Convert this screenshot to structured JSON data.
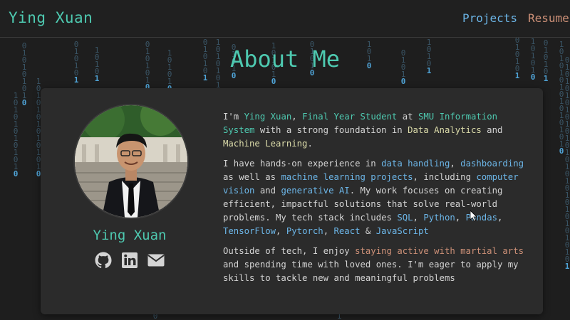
{
  "navbar": {
    "brand": "Ying Xuan",
    "links": [
      {
        "label": "Projects"
      },
      {
        "label": "Resume"
      }
    ]
  },
  "heading": "About Me",
  "profile": {
    "name": "Ying Xuan",
    "socials": [
      "github-icon",
      "linkedin-icon",
      "email-icon"
    ]
  },
  "bio": {
    "p1": [
      {
        "text": "I'm ",
        "style": "plain"
      },
      {
        "text": "Ying Xuan",
        "style": "teal"
      },
      {
        "text": ", ",
        "style": "plain"
      },
      {
        "text": "Final Year Student",
        "style": "teal"
      },
      {
        "text": " at ",
        "style": "plain"
      },
      {
        "text": "SMU Information System",
        "style": "teal"
      },
      {
        "text": " with a strong foundation in ",
        "style": "plain"
      },
      {
        "text": "Data Analytics",
        "style": "yellow"
      },
      {
        "text": " and ",
        "style": "plain"
      },
      {
        "text": "Machine Learning",
        "style": "yellow"
      },
      {
        "text": ".",
        "style": "plain"
      }
    ],
    "p2": [
      {
        "text": "I have hands-on experience in ",
        "style": "plain"
      },
      {
        "text": "data handling",
        "style": "blue"
      },
      {
        "text": ", ",
        "style": "plain"
      },
      {
        "text": "dashboarding",
        "style": "blue"
      },
      {
        "text": " as well as ",
        "style": "plain"
      },
      {
        "text": "machine learning projects",
        "style": "blue"
      },
      {
        "text": ", including ",
        "style": "plain"
      },
      {
        "text": "computer vision",
        "style": "blue"
      },
      {
        "text": " and ",
        "style": "plain"
      },
      {
        "text": "generative AI",
        "style": "blue"
      },
      {
        "text": ". My work focuses on creating efficient, impactful solutions that solve real-world problems. My tech stack includes ",
        "style": "plain"
      },
      {
        "text": "SQL",
        "style": "blue"
      },
      {
        "text": ", ",
        "style": "plain"
      },
      {
        "text": "Python",
        "style": "blue"
      },
      {
        "text": ", ",
        "style": "plain"
      },
      {
        "text": "Pandas",
        "style": "blue"
      },
      {
        "text": ", ",
        "style": "plain"
      },
      {
        "text": "TensorFlow",
        "style": "blue"
      },
      {
        "text": ", ",
        "style": "plain"
      },
      {
        "text": "Pytorch",
        "style": "blue"
      },
      {
        "text": ", ",
        "style": "plain"
      },
      {
        "text": "React",
        "style": "blue"
      },
      {
        "text": " & ",
        "style": "plain"
      },
      {
        "text": "JavaScript",
        "style": "blue"
      }
    ],
    "p3": [
      {
        "text": "Outside of tech, I enjoy ",
        "style": "plain"
      },
      {
        "text": "staying active with martial arts",
        "style": "orange"
      },
      {
        "text": " and spending time with loved ones. I'm eager to apply my skills to tackle new and meaningful problems",
        "style": "plain"
      }
    ]
  },
  "colors": {
    "background": "#1e1e1e",
    "card": "#2b2b2b",
    "accent_teal": "#4ec9b0",
    "accent_yellow": "#dcdcaa",
    "accent_blue": "#6cb6e8",
    "accent_orange": "#ce9178"
  }
}
